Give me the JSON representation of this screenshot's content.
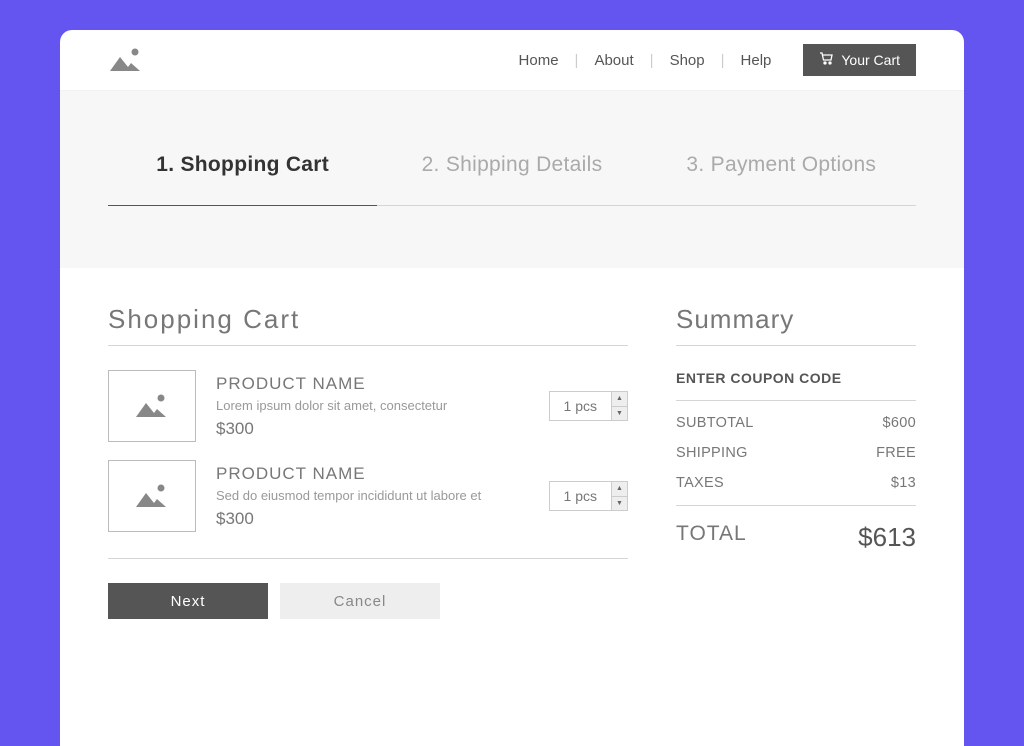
{
  "nav": {
    "home": "Home",
    "about": "About",
    "shop": "Shop",
    "help": "Help",
    "cart": "Your Cart"
  },
  "steps": {
    "s1": "1. Shopping Cart",
    "s2": "2. Shipping Details",
    "s3": "3. Payment Options"
  },
  "cart": {
    "title": "Shopping Cart",
    "items": [
      {
        "name": "PRODUCT NAME",
        "desc": "Lorem ipsum dolor sit amet, consectetur",
        "price": "$300",
        "qty": "1 pcs"
      },
      {
        "name": "PRODUCT NAME",
        "desc": "Sed do eiusmod tempor incididunt ut labore et",
        "price": "$300",
        "qty": "1 pcs"
      }
    ],
    "next": "Next",
    "cancel": "Cancel"
  },
  "summary": {
    "title": "Summary",
    "coupon": "ENTER COUPON CODE",
    "subtotal_label": "SUBTOTAL",
    "subtotal_value": "$600",
    "shipping_label": "SHIPPING",
    "shipping_value": "FREE",
    "taxes_label": "TAXES",
    "taxes_value": "$13",
    "total_label": "TOTAL",
    "total_value": "$613"
  }
}
